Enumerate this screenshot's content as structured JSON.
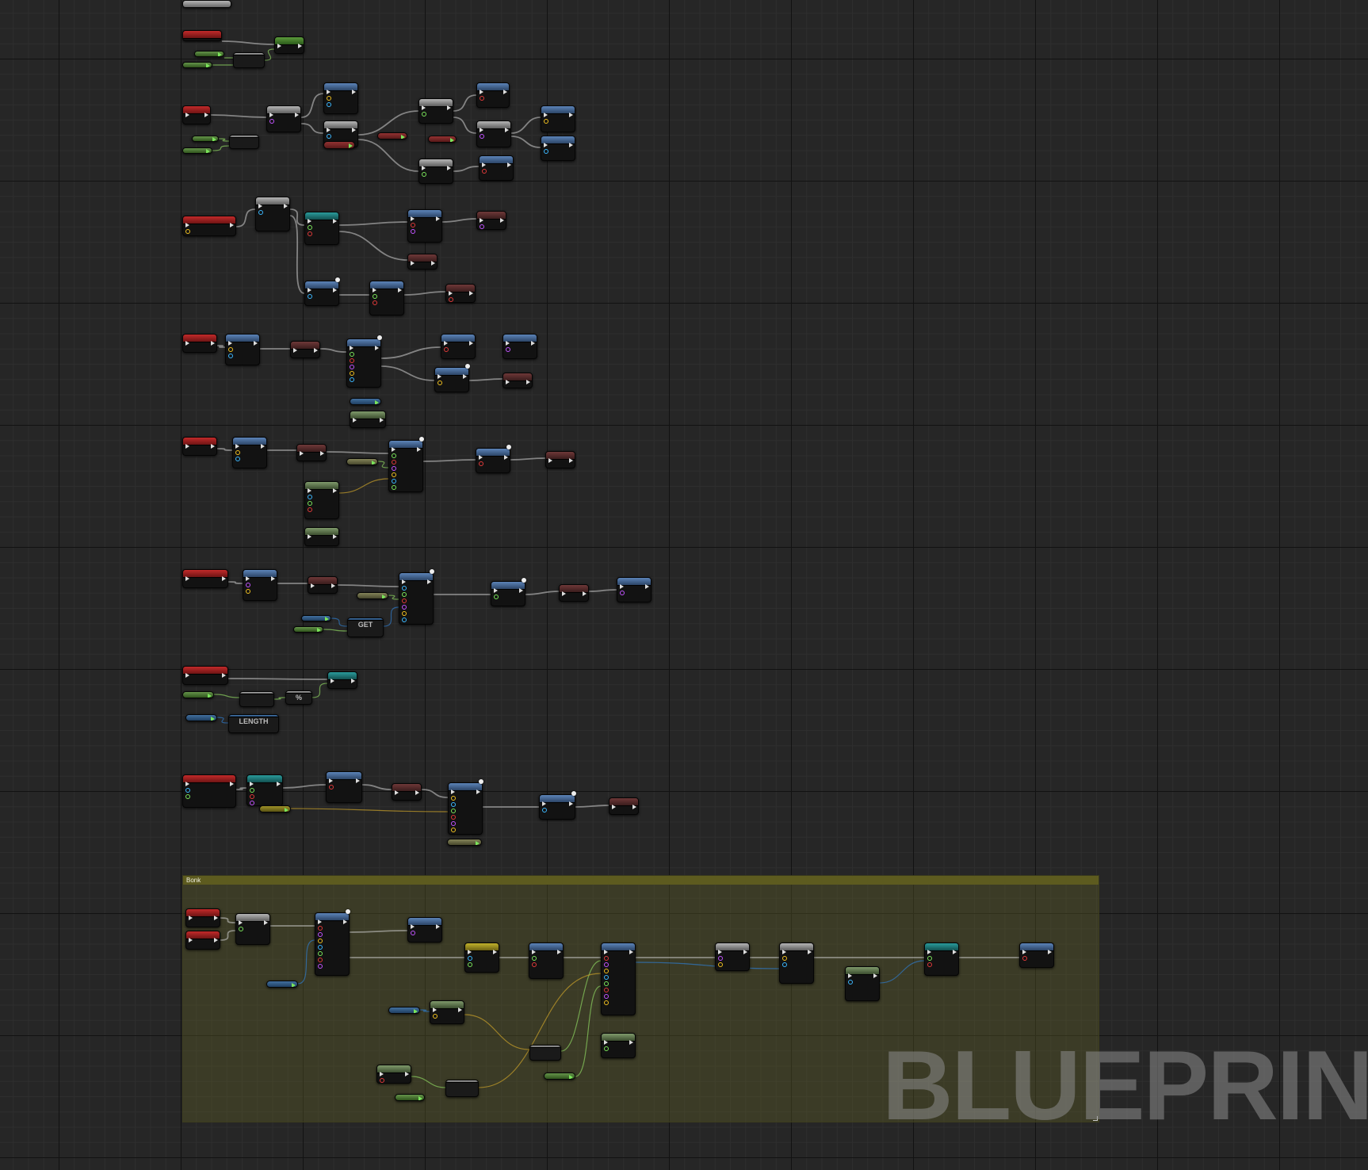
{
  "graph": {
    "comment_title": "Bonk",
    "watermark": "BLUEPRINT",
    "compact_labels": [
      "GET",
      "LENGTH",
      "%"
    ]
  },
  "colors": {
    "background": "#262626",
    "grid_major": "#121212",
    "grid_minor": "#2e2e2e",
    "exec_wire": "#d0d0d0",
    "object_wire": "#2f7ac9",
    "struct_wire": "#c8a02a",
    "float_wire": "#8bd15f",
    "comment_fill": "#5f5f28"
  },
  "icons": [
    "event-node-icon",
    "function-node-icon",
    "set-variable-node-icon",
    "pure-node-icon",
    "reroute-icon"
  ]
}
